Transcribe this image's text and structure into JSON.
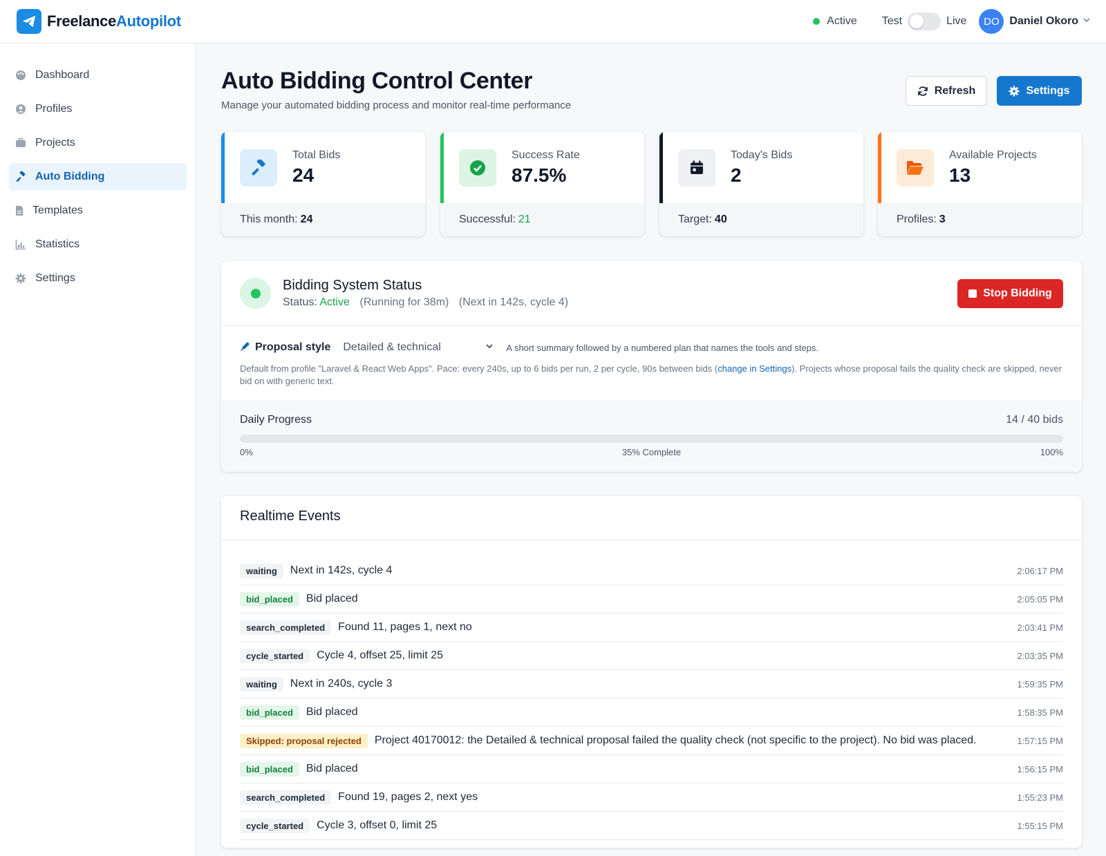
{
  "app": {
    "name_part1": "Freelance",
    "name_part2": "Autopilot"
  },
  "topbar": {
    "status": "Active",
    "mode_left": "Test",
    "mode_right": "Live",
    "user_initials": "DO",
    "user_name": "Daniel Okoro"
  },
  "sidebar": {
    "items": [
      {
        "label": "Dashboard",
        "icon": "palette-icon"
      },
      {
        "label": "Profiles",
        "icon": "user-circle-icon"
      },
      {
        "label": "Projects",
        "icon": "briefcase-icon"
      },
      {
        "label": "Auto Bidding",
        "icon": "gavel-icon",
        "active": true
      },
      {
        "label": "Templates",
        "icon": "file-icon"
      },
      {
        "label": "Statistics",
        "icon": "bar-chart-icon"
      },
      {
        "label": "Settings",
        "icon": "gear-icon"
      }
    ]
  },
  "header": {
    "title": "Auto Bidding Control Center",
    "subtitle": "Manage your automated bidding process and monitor real-time performance",
    "refresh_label": "Refresh",
    "settings_label": "Settings"
  },
  "stats": [
    {
      "label": "Total Bids",
      "value": "24",
      "foot_label": "This month:",
      "foot_value": "24",
      "accent": "#1a8ce3"
    },
    {
      "label": "Success Rate",
      "value": "87.5%",
      "foot_label": "Successful:",
      "foot_value": "21",
      "accent": "#22c55e"
    },
    {
      "label": "Today's Bids",
      "value": "2",
      "foot_label": "Target:",
      "foot_value": "40",
      "accent": "#111827"
    },
    {
      "label": "Available Projects",
      "value": "13",
      "foot_label": "Profiles:",
      "foot_value": "3",
      "accent": "#f97316"
    }
  ],
  "system": {
    "title": "Bidding System Status",
    "status_prefix": "Status:",
    "status": "Active",
    "running": "(Running for 38m)",
    "next": "(Next in 142s, cycle 4)",
    "stop_label": "Stop Bidding",
    "proposal_label": "Proposal style",
    "proposal_value": "Detailed & technical",
    "proposal_hint": "A short summary followed by a numbered plan that names the tools and steps.",
    "note_before": "Default from profile \"Laravel & React Web Apps\". Pace: every 240s, up to 6 bids per run, 2 per cycle, 90s between bids (",
    "note_link": "change in Settings",
    "note_after": "). Projects whose proposal fails the quality check are skipped, never bid on with generic text."
  },
  "progress": {
    "title": "Daily Progress",
    "count": "14 / 40 bids",
    "min_label": "0%",
    "mid_label": "35% Complete",
    "max_label": "100%",
    "fraction": 0.35
  },
  "events": {
    "title": "Realtime Events",
    "rows": [
      {
        "badge": "waiting",
        "tone": "gray",
        "message": "Next in 142s, cycle 4",
        "time": "2:06:17 PM"
      },
      {
        "badge": "bid_placed",
        "tone": "green",
        "message": "Bid placed",
        "time": "2:05:05 PM"
      },
      {
        "badge": "search_completed",
        "tone": "gray",
        "message": "Found 11, pages 1, next no",
        "time": "2:03:41 PM"
      },
      {
        "badge": "cycle_started",
        "tone": "gray",
        "message": "Cycle 4, offset 25, limit 25",
        "time": "2:03:35 PM"
      },
      {
        "badge": "waiting",
        "tone": "gray",
        "message": "Next in 240s, cycle 3",
        "time": "1:59:35 PM"
      },
      {
        "badge": "bid_placed",
        "tone": "green",
        "message": "Bid placed",
        "time": "1:58:35 PM"
      },
      {
        "badge": "Skipped: proposal rejected",
        "tone": "yellow",
        "message": "Project 40170012: the Detailed & technical proposal failed the quality check (not specific to the project). No bid was placed.",
        "time": "1:57:15 PM"
      },
      {
        "badge": "bid_placed",
        "tone": "green",
        "message": "Bid placed",
        "time": "1:56:15 PM"
      },
      {
        "badge": "search_completed",
        "tone": "gray",
        "message": "Found 19, pages 2, next yes",
        "time": "1:55:23 PM"
      },
      {
        "badge": "cycle_started",
        "tone": "gray",
        "message": "Cycle 3, offset 0, limit 25",
        "time": "1:55:15 PM"
      }
    ]
  }
}
